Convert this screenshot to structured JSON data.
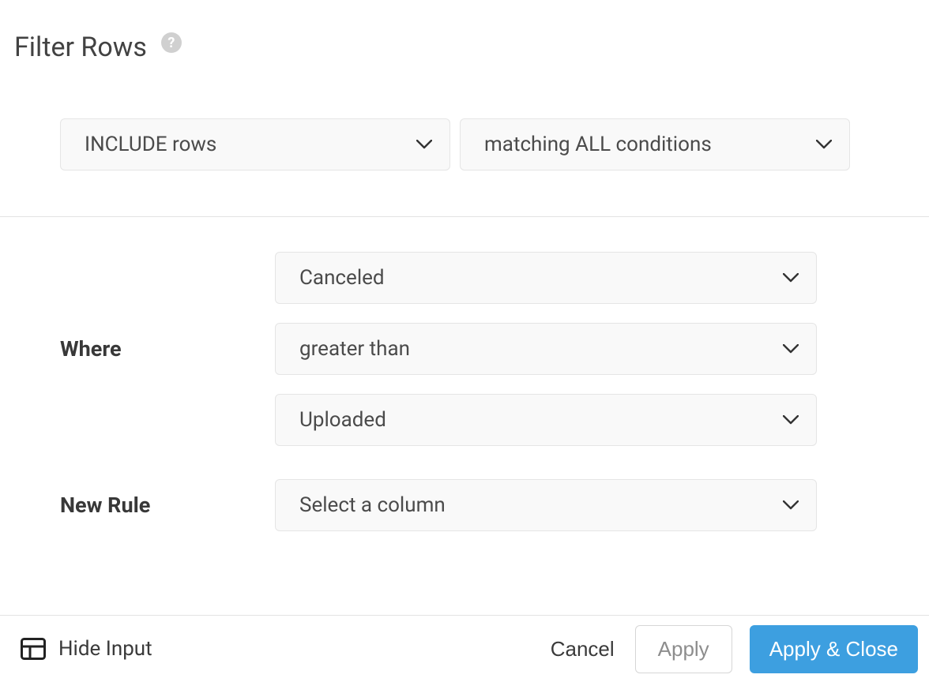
{
  "header": {
    "title": "Filter Rows"
  },
  "filter": {
    "mode": "INCLUDE rows",
    "match": "matching ALL conditions"
  },
  "rule": {
    "label": "Where",
    "column": "Canceled",
    "operator": "greater than",
    "value": "Uploaded"
  },
  "newRule": {
    "label": "New Rule",
    "placeholder": "Select a column"
  },
  "footer": {
    "hideInput": "Hide Input",
    "cancel": "Cancel",
    "apply": "Apply",
    "applyClose": "Apply & Close"
  },
  "colors": {
    "primary": "#3d9fe0",
    "border": "#e3e3e3",
    "selectBg": "#f9f9f9",
    "text": "#4b4b4b",
    "muted": "#8d8d8d"
  }
}
